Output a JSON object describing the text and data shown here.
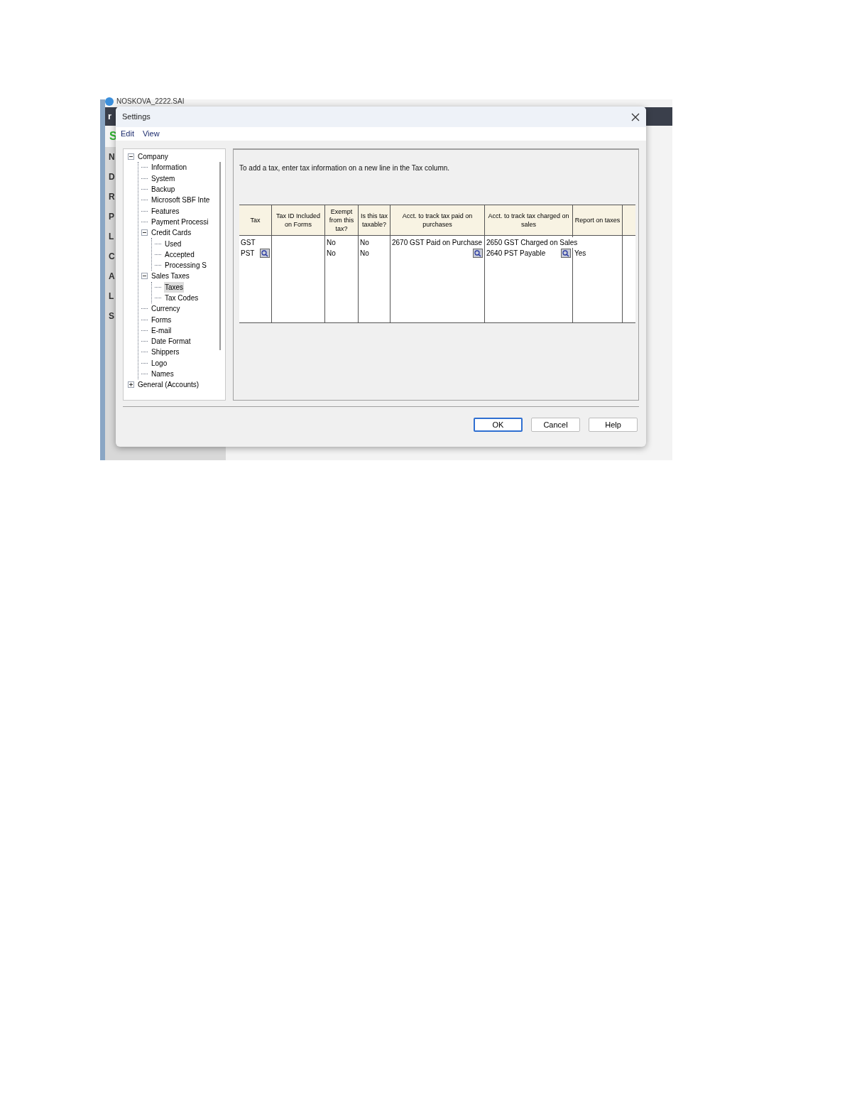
{
  "app": {
    "title": "NOSKOVA_2222.SAI",
    "side_letters": [
      "N",
      "D",
      "R",
      "P",
      "L",
      "C",
      "A",
      "L",
      "S"
    ],
    "toolbar_letter": "r",
    "logo_letter": "S"
  },
  "dialog": {
    "title": "Settings",
    "menu": [
      "Edit",
      "View"
    ],
    "tree": [
      {
        "label": "Company",
        "expanded": true,
        "selected": false,
        "children": [
          {
            "label": "Information",
            "selected": false
          },
          {
            "label": "System",
            "selected": false
          },
          {
            "label": "Backup",
            "selected": false
          },
          {
            "label": "Microsoft SBF Inte",
            "selected": false
          },
          {
            "label": "Features",
            "selected": false
          },
          {
            "label": "Payment Processi",
            "selected": false
          },
          {
            "label": "Credit Cards",
            "expanded": true,
            "selected": false,
            "children": [
              {
                "label": "Used",
                "selected": false
              },
              {
                "label": "Accepted",
                "selected": false
              },
              {
                "label": "Processing S",
                "selected": false
              }
            ]
          },
          {
            "label": "Sales Taxes",
            "expanded": true,
            "selected": false,
            "children": [
              {
                "label": "Taxes",
                "selected": true
              },
              {
                "label": "Tax Codes",
                "selected": false
              }
            ]
          },
          {
            "label": "Currency",
            "selected": false
          },
          {
            "label": "Forms",
            "selected": false
          },
          {
            "label": "E-mail",
            "selected": false
          },
          {
            "label": "Date Format",
            "selected": false
          },
          {
            "label": "Shippers",
            "selected": false
          },
          {
            "label": "Logo",
            "selected": false
          },
          {
            "label": "Names",
            "selected": false
          }
        ]
      },
      {
        "label": "General (Accounts)",
        "expanded": false,
        "selected": false
      }
    ],
    "instruction": "To add a tax, enter tax information on a new line in the Tax column.",
    "table": {
      "columns": [
        "Tax",
        "Tax ID Included on Forms",
        "Exempt from this tax?",
        "Is this tax taxable?",
        "Acct. to track tax paid on purchases",
        "Acct. to track tax charged on sales",
        "Report on taxes"
      ],
      "rows": [
        {
          "tax": "GST",
          "tax_id": "",
          "exempt": "No",
          "taxable": "No",
          "paid_acct": "2670 GST Paid on Purchase",
          "charged_acct": "2650 GST Charged on Sales",
          "report": "",
          "lookup": false
        },
        {
          "tax": "PST",
          "tax_id": "",
          "exempt": "No",
          "taxable": "No",
          "paid_acct": "",
          "charged_acct": "2640 PST Payable",
          "report": "Yes",
          "lookup": true
        }
      ]
    },
    "buttons": [
      {
        "label": "OK",
        "default": true
      },
      {
        "label": "Cancel",
        "default": false
      },
      {
        "label": "Help",
        "default": false
      }
    ]
  }
}
